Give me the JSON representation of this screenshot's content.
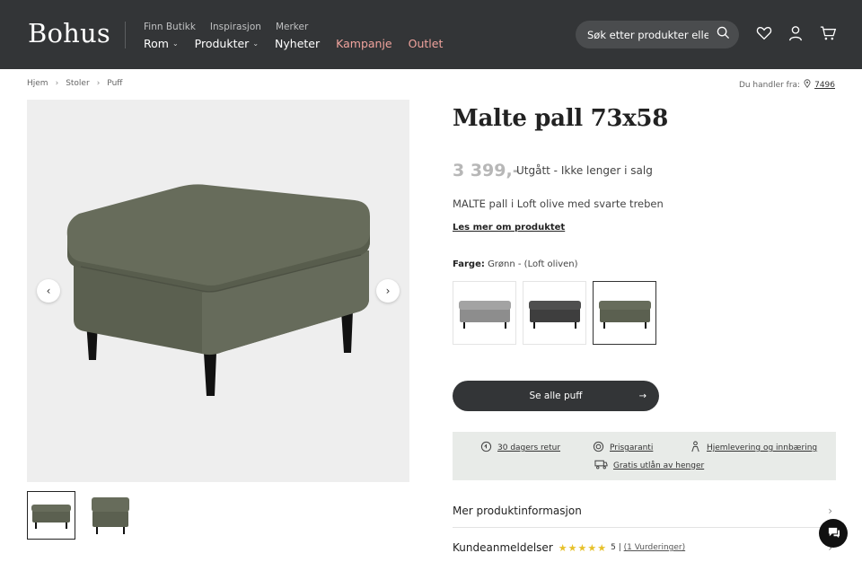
{
  "header": {
    "logo": "Bohus",
    "top_links": [
      "Finn Butikk",
      "Inspirasjon",
      "Merker"
    ],
    "main_nav": {
      "rom": "Rom",
      "produkter": "Produkter",
      "nyheter": "Nyheter",
      "kampanje": "Kampanje",
      "outlet": "Outlet"
    },
    "search_placeholder": "Søk etter produkter eller innhold"
  },
  "breadcrumb": [
    "Hjem",
    "Stoler",
    "Puff"
  ],
  "store": {
    "label": "Du handler fra:",
    "number": "7496"
  },
  "product": {
    "title": "Malte pall 73x58",
    "price": "3 399,-",
    "status": "Utgått - Ikke lenger i salg",
    "description": "MALTE pall i Loft olive med svarte treben",
    "read_more": "Les mer om produktet",
    "color_label": "Farge:",
    "color_value": "Grønn - (Loft oliven)",
    "cta": "Se alle puff"
  },
  "colors": {
    "grey": "#9b9b9b",
    "dark": "#4a4a4a",
    "olive": "#5f6552",
    "accent": "#f0a39d"
  },
  "usp": [
    "30 dagers retur",
    "Prisgaranti",
    "Hjemlevering og innbæring",
    "Gratis utlån av henger"
  ],
  "accordion": {
    "info": "Mer produktinformasjon",
    "reviews": "Kundeanmeldelser",
    "rating_value": "5",
    "rating_count": "(1 Vurderinger)",
    "stars": 5
  }
}
